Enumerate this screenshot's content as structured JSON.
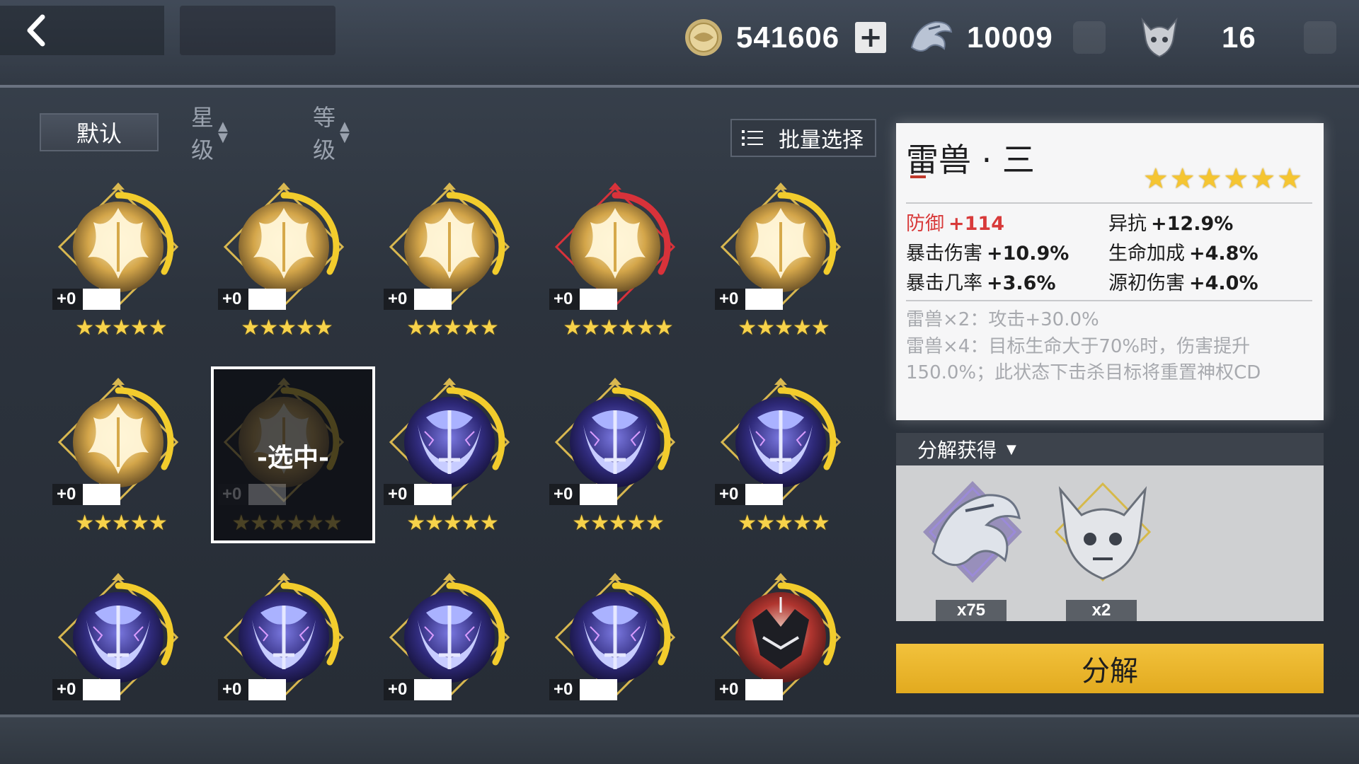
{
  "header": {
    "gold": "541606",
    "dragon_currency": "10009",
    "skull_currency": "16"
  },
  "sort": {
    "default": "默认",
    "star": "星级",
    "level": "等级",
    "batch_select": "批量选择"
  },
  "items": [
    {
      "type": "gold",
      "level": "+0",
      "stars": "★★★★★",
      "ring": "yellow"
    },
    {
      "type": "gold",
      "level": "+0",
      "stars": "★★★★★",
      "ring": "yellow"
    },
    {
      "type": "gold",
      "level": "+0",
      "stars": "★★★★★",
      "ring": "yellow"
    },
    {
      "type": "gold",
      "level": "+0",
      "stars": "★★★★★★",
      "ring": "red"
    },
    {
      "type": "gold",
      "level": "+0",
      "stars": "★★★★★",
      "ring": "yellow"
    },
    {
      "type": "gold",
      "level": "+0",
      "stars": "★★★★★",
      "ring": "yellow"
    },
    {
      "type": "selected",
      "level": "+0",
      "stars": "★★★★★★",
      "label": "-选中-"
    },
    {
      "type": "thunder",
      "level": "+0",
      "stars": "★★★★★",
      "ring": "yellow"
    },
    {
      "type": "thunder",
      "level": "+0",
      "stars": "★★★★★",
      "ring": "yellow"
    },
    {
      "type": "thunder",
      "level": "+0",
      "stars": "★★★★★",
      "ring": "yellow"
    },
    {
      "type": "thunder",
      "level": "+0",
      "stars": "",
      "ring": "yellow"
    },
    {
      "type": "thunder",
      "level": "+0",
      "stars": "",
      "ring": "yellow"
    },
    {
      "type": "thunder",
      "level": "+0",
      "stars": "",
      "ring": "yellow"
    },
    {
      "type": "thunder",
      "level": "+0",
      "stars": "",
      "ring": "yellow"
    },
    {
      "type": "wolf",
      "level": "+0",
      "stars": "",
      "ring": "yellow"
    }
  ],
  "detail": {
    "name": "雷兽 · 三",
    "stars": "★★★★★★",
    "stats": [
      {
        "label": "防御",
        "value": "+114",
        "highlight": true
      },
      {
        "label": "异抗",
        "value": "+12.9%"
      },
      {
        "label": "暴击伤害",
        "value": "+10.9%"
      },
      {
        "label": "生命加成",
        "value": "+4.8%"
      },
      {
        "label": "暴击几率",
        "value": "+3.6%"
      },
      {
        "label": "源初伤害",
        "value": "+4.0%"
      }
    ],
    "set2": "雷兽×2：攻击+30.0%",
    "set4": "雷兽×4：目标生命大于70%时，伤害提升150.0%；此状态下击杀目标将重置神权CD"
  },
  "decompose": {
    "header": "分解获得",
    "rewards": [
      {
        "icon": "dragon-icon",
        "count": "x75"
      },
      {
        "icon": "skull-icon",
        "count": "x2"
      }
    ],
    "button": "分解"
  },
  "colors": {
    "gold_ring": "#f2cc2c",
    "red_ring": "#d8323a",
    "button": "#ebb72e",
    "highlight": "#d83a3a"
  }
}
